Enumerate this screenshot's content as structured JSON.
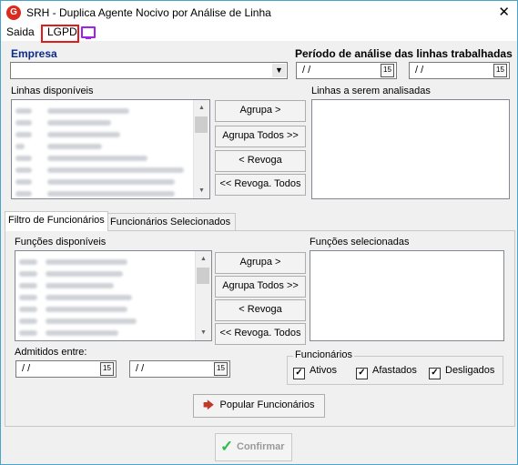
{
  "window": {
    "title": "SRH - Duplica Agente Nocivo por Análise de Linha",
    "app_icon_letter": "G"
  },
  "menu": {
    "saida": "Saida",
    "lgpd": "LGPD"
  },
  "empresa": {
    "label": "Empresa",
    "value": ""
  },
  "periodo": {
    "label": "Período de análise das linhas trabalhadas",
    "start": "/ /",
    "end": "/ /"
  },
  "linhas": {
    "available_label": "Linhas disponíveis",
    "selected_label": "Linhas a serem analisadas",
    "buttons": {
      "agrupa": "Agrupa >",
      "agrupa_todos": "Agrupa Todos >>",
      "revoga": "< Revoga",
      "revoga_todos": "<< Revoga. Todos"
    }
  },
  "tabs": {
    "filtro": "Filtro de Funcionários",
    "selecionados": "Funcionários Selecionados"
  },
  "funcoes": {
    "available_label": "Funções disponíveis",
    "selected_label": "Funções selecionadas",
    "buttons": {
      "agrupa": "Agrupa >",
      "agrupa_todos": "Agrupa Todos >>",
      "revoga": "< Revoga",
      "revoga_todos": "<< Revoga. Todos"
    }
  },
  "admitidos": {
    "label": "Admitidos entre:",
    "start": "/ /",
    "end": "/ /"
  },
  "funcionarios_group": {
    "label": "Funcionários",
    "ativos": "Ativos",
    "ativos_checked": true,
    "afastados": "Afastados",
    "afastados_checked": true,
    "desligados": "Desligados",
    "desligados_checked": true
  },
  "popular_button": "Popular Funcionários",
  "confirm_button": "Confirmar",
  "icons": {
    "close": "close-icon",
    "monitor": "monitor-icon",
    "calendar": "calendar-icon",
    "confirm": "checkmark-icon",
    "popular": "document-arrow-icon"
  },
  "colors": {
    "accent_blue": "#0a2a8c",
    "highlight_red": "#e01b1b",
    "monitor_purple": "#a020f0",
    "confirm_green": "#2dbb4e"
  }
}
